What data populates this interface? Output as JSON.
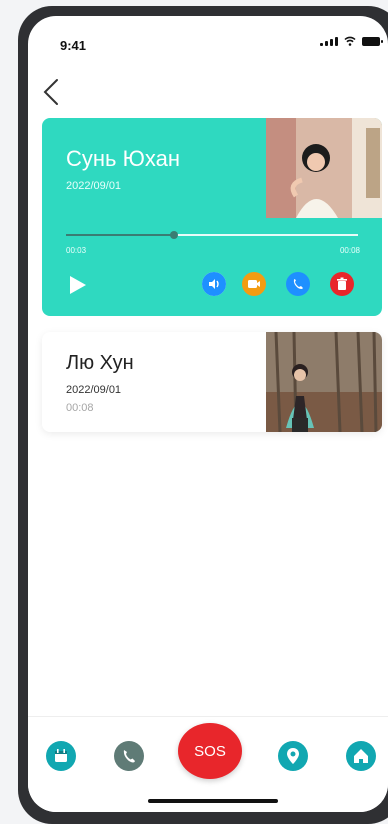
{
  "status_bar": {
    "time": "9:41"
  },
  "colors": {
    "accent": "#2fd9c0",
    "sos": "#e8262b",
    "nav_teal": "#11a7b1",
    "nav_gray": "#5f7b76",
    "speaker": "#1e90ff",
    "video": "#f39c12",
    "phone": "#1e90ff",
    "trash": "#e8262b"
  },
  "records": [
    {
      "name": "Сунь Юхан",
      "date": "2022/09/01",
      "progress": {
        "current": "00:03",
        "total": "00:08",
        "fraction": 0.37
      },
      "actions": [
        "speaker-icon",
        "video-camera-icon",
        "phone-icon",
        "trash-icon"
      ]
    },
    {
      "name": "Лю Хун",
      "date": "2022/09/01",
      "duration": "00:08"
    }
  ],
  "bottom_nav": {
    "sos_label": "SOS",
    "icons": [
      "calendar-icon",
      "phone-icon",
      "location-pin-icon",
      "home-icon"
    ]
  }
}
